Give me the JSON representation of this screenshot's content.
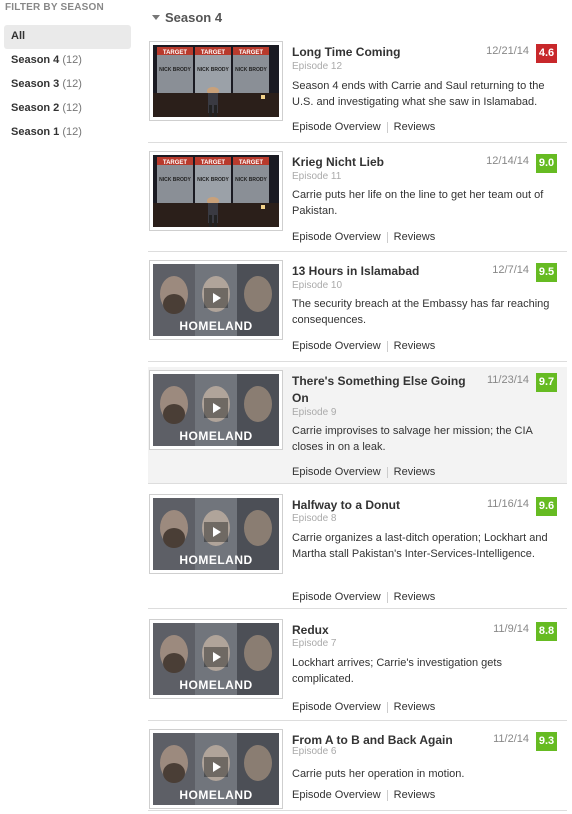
{
  "sidebar": {
    "title": "FILTER BY SEASON",
    "items": [
      {
        "label": "All",
        "count": ""
      },
      {
        "label": "Season 4",
        "count": "(12)"
      },
      {
        "label": "Season 3",
        "count": "(12)"
      },
      {
        "label": "Season 2",
        "count": "(12)"
      },
      {
        "label": "Season 1",
        "count": "(12)"
      }
    ]
  },
  "main": {
    "season_title": "Season 4",
    "links": {
      "overview": "Episode Overview",
      "reviews": "Reviews"
    },
    "episodes": [
      {
        "title": "Long Time Coming",
        "number": "Episode 12",
        "date": "12/21/14",
        "score": "4.6",
        "score_color": "#c8282b",
        "thumb": "poster",
        "description": "Season 4 ends with Carrie and Saul returning to the U.S. and investigating what she saw in Islamabad."
      },
      {
        "title": "Krieg Nicht Lieb",
        "number": "Episode 11",
        "date": "12/14/14",
        "score": "9.0",
        "score_color": "#66bb22",
        "thumb": "poster",
        "description": "Carrie puts her life on the line to get her team out of Pakistan."
      },
      {
        "title": "13 Hours in Islamabad",
        "number": "Episode 10",
        "date": "12/7/14",
        "score": "9.5",
        "score_color": "#66bb22",
        "thumb": "video",
        "description": "The security breach at the Embassy has far reaching consequences."
      },
      {
        "title": "There's Something Else Going On",
        "number": "Episode 9",
        "date": "11/23/14",
        "score": "9.7",
        "score_color": "#66bb22",
        "thumb": "video",
        "description": "Carrie improvises to salvage her mission; the CIA closes in on a leak."
      },
      {
        "title": "Halfway to a Donut",
        "number": "Episode 8",
        "date": "11/16/14",
        "score": "9.6",
        "score_color": "#66bb22",
        "thumb": "video",
        "description": "Carrie organizes a last-ditch operation; Lockhart and Martha stall Pakistan's Inter-Services-Intelligence."
      },
      {
        "title": "Redux",
        "number": "Episode 7",
        "date": "11/9/14",
        "score": "8.8",
        "score_color": "#66bb22",
        "thumb": "video",
        "description": "Lockhart arrives; Carrie's investigation gets complicated."
      },
      {
        "title": "From A to B and Back Again",
        "number": "Episode 6",
        "date": "11/2/14",
        "score": "9.3",
        "score_color": "#66bb22",
        "thumb": "video",
        "description": "Carrie puts her operation in motion."
      }
    ],
    "thumb_text": {
      "poster_banner": "TARGET",
      "poster_name": "NICK BRODY",
      "video_logo": "HOMELAND"
    }
  }
}
